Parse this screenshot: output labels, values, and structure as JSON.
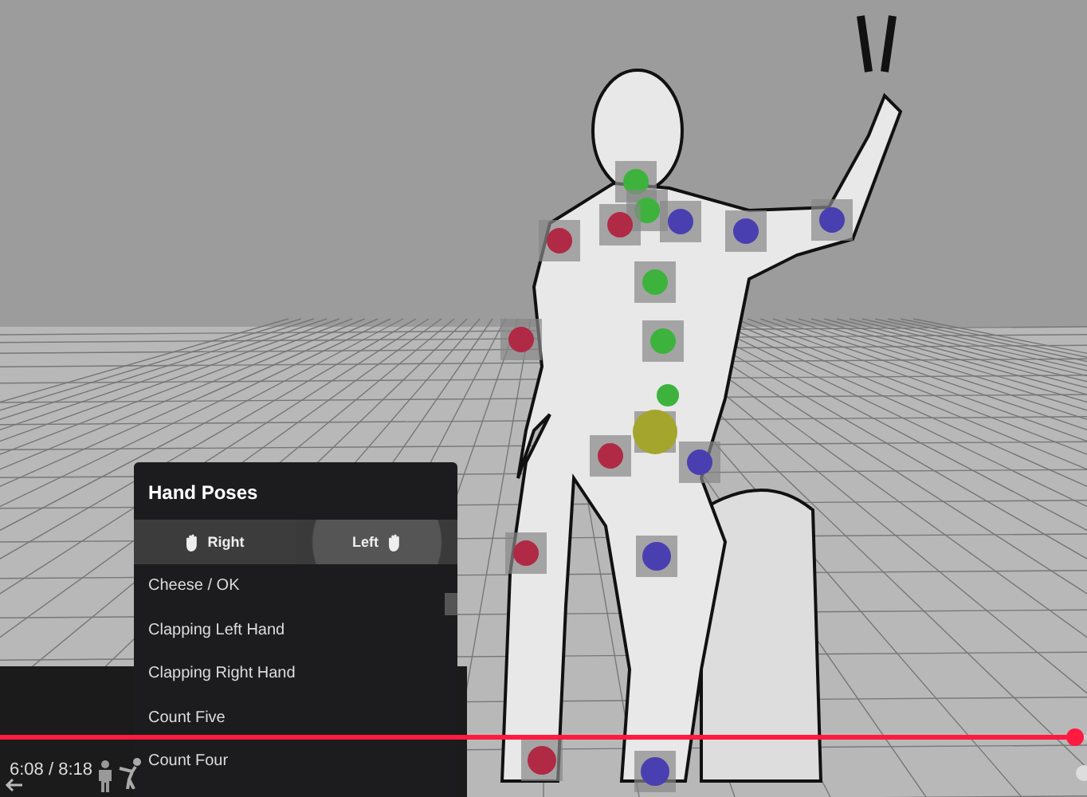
{
  "menu": {
    "title": "Hand Poses",
    "tabs": [
      {
        "label": "Right",
        "selected": false
      },
      {
        "label": "Left",
        "selected": true
      }
    ],
    "items": [
      "Cheese / OK",
      "Clapping Left Hand",
      "Clapping Right Hand",
      "Count Five",
      "Count Four"
    ]
  },
  "player": {
    "time": "6:08 / 8:18",
    "progress": {
      "level": 0.99
    }
  }
}
